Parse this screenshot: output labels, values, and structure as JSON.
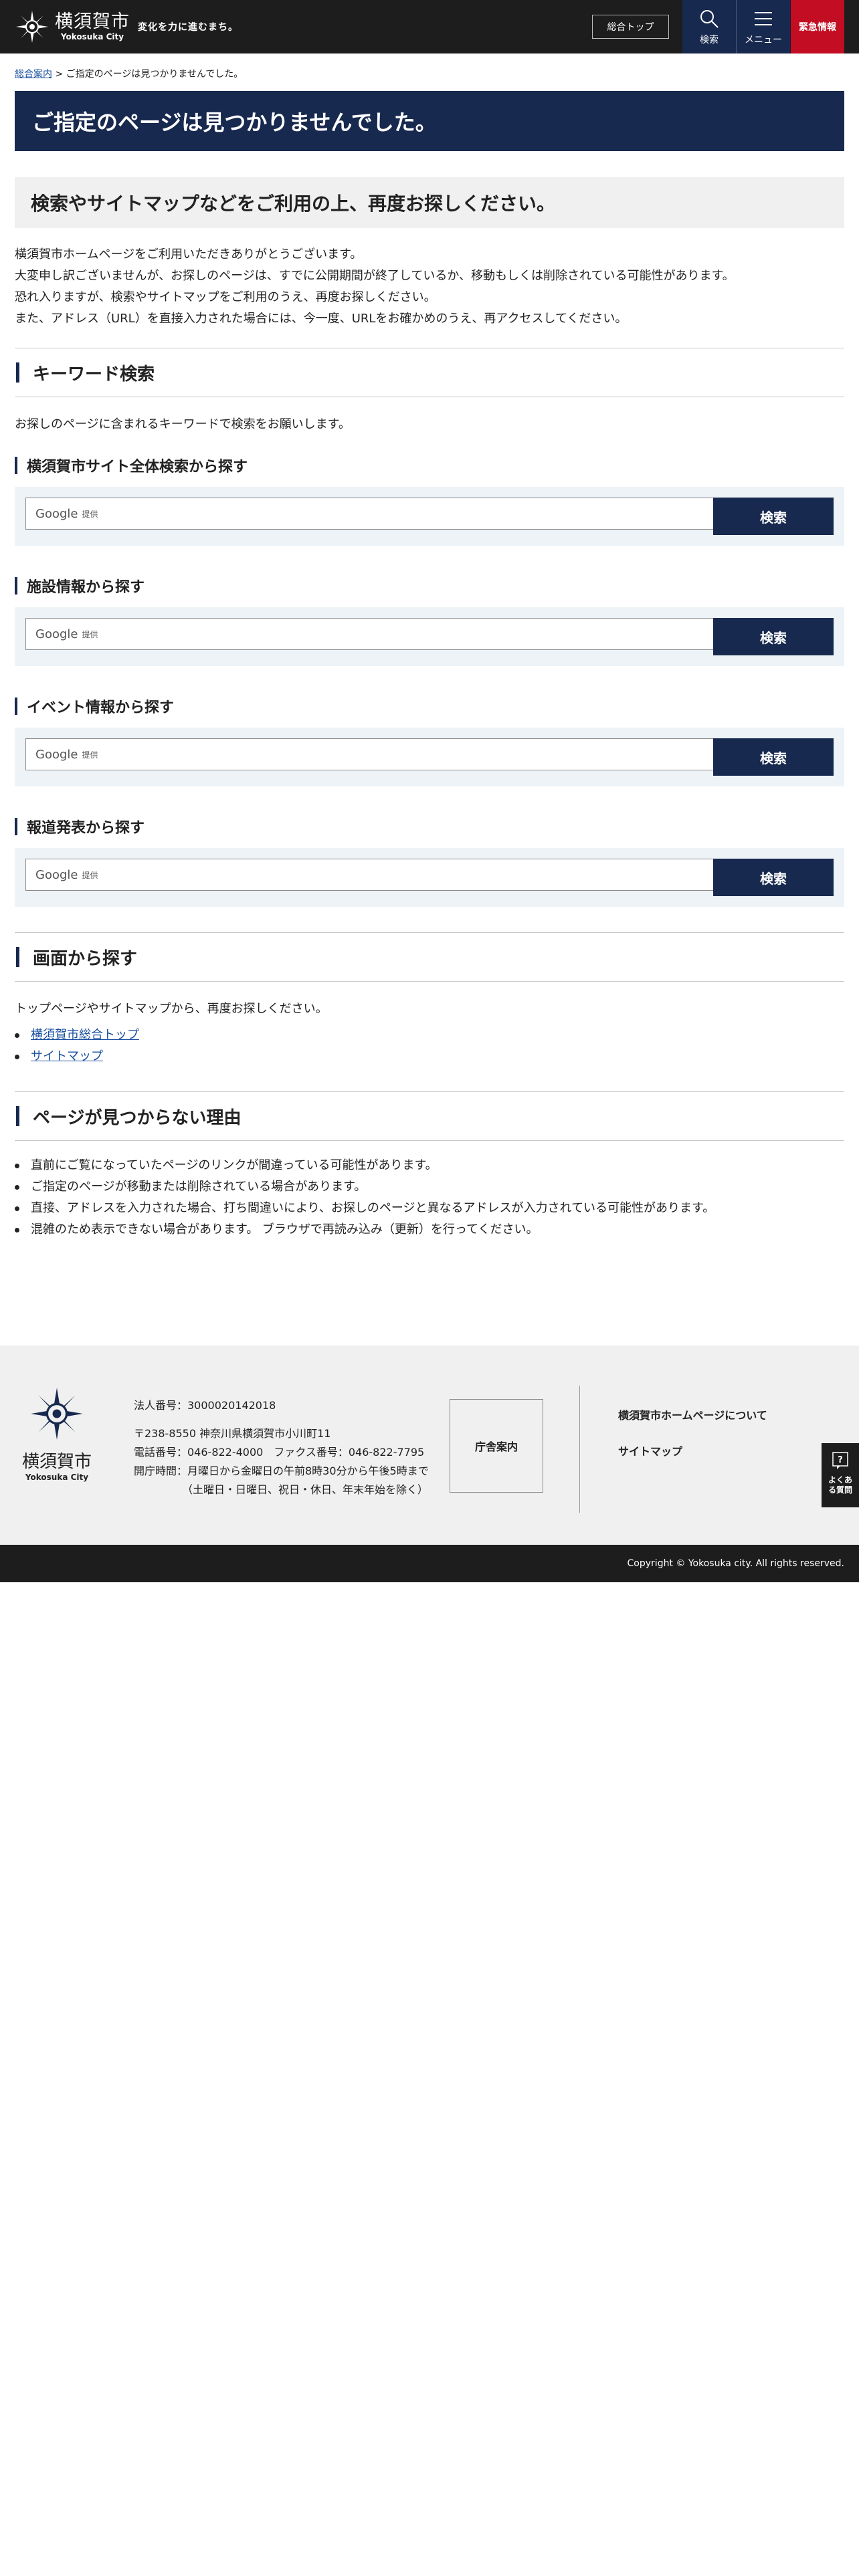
{
  "header": {
    "logo_ja": "横須賀市",
    "logo_en": "Yokosuka City",
    "tagline": "変化を力に進むまち。",
    "top_link": "総合トップ",
    "search_label": "検索",
    "menu_label": "メニュー",
    "emergency_label": "緊急情報"
  },
  "breadcrumb": {
    "home": "総合案内",
    "separator": ">",
    "current": "ご指定のページは見つかりませんでした。"
  },
  "page_title": "ご指定のページは見つかりませんでした。",
  "subtitle": "検索やサイトマップなどをご利用の上、再度お探しください。",
  "intro": [
    "横須賀市ホームページをご利用いただきありがとうございます。",
    "大変申し訳ございませんが、お探しのページは、すでに公開期間が終了しているか、移動もしくは削除されている可能性があります。",
    "恐れ入りますが、検索やサイトマップをご利用のうえ、再度お探しください。",
    "また、アドレス（URL）を直接入力された場合には、今一度、URLをお確かめのうえ、再アクセスしてください。"
  ],
  "keyword_section": {
    "heading": "キーワード検索",
    "description": "お探しのページに含まれるキーワードで検索をお願いします。",
    "google_label": "Google",
    "google_provided": "提供",
    "search_button": "検索",
    "searches": [
      {
        "title": "横須賀市サイト全体検索から探す"
      },
      {
        "title": "施設情報から探す"
      },
      {
        "title": "イベント情報から探す"
      },
      {
        "title": "報道発表から探す"
      }
    ]
  },
  "screen_section": {
    "heading": "画面から探す",
    "description": "トップページやサイトマップから、再度お探しください。",
    "links": [
      "横須賀市総合トップ",
      "サイトマップ"
    ]
  },
  "reason_section": {
    "heading": "ページが見つからない理由",
    "items": [
      "直前にご覧になっていたページのリンクが間違っている可能性があります。",
      "ご指定のページが移動または削除されている場合があります。",
      "直接、アドレスを入力された場合、打ち間違いにより、お探しのページと異なるアドレスが入力されている可能性があります。",
      "混雑のため表示できない場合があります。 ブラウザで再読み込み（更新）を行ってください。"
    ]
  },
  "footer": {
    "logo_ja": "横須賀市",
    "logo_en": "Yokosuka City",
    "corp_number": "法人番号：3000020142018",
    "address": "〒238-8550 神奈川県横須賀市小川町11",
    "phone": "電話番号：046-822-4000　ファクス番号：046-822-7795",
    "hours": "開庁時間：月曜日から金曜日の午前8時30分から午後5時まで",
    "hours_note": "（土曜日・日曜日、祝日・休日、年末年始を除く）",
    "chosha": "庁舎案内",
    "links": [
      "横須賀市ホームページについて",
      "サイトマップ"
    ],
    "faq_label": "よくある質問",
    "copyright": "Copyright © Yokosuka city. All rights reserved."
  },
  "colors": {
    "navy": "#18294f",
    "emergency": "#c30d23",
    "dark": "#1d1d1d",
    "link": "#1a4fa0"
  }
}
